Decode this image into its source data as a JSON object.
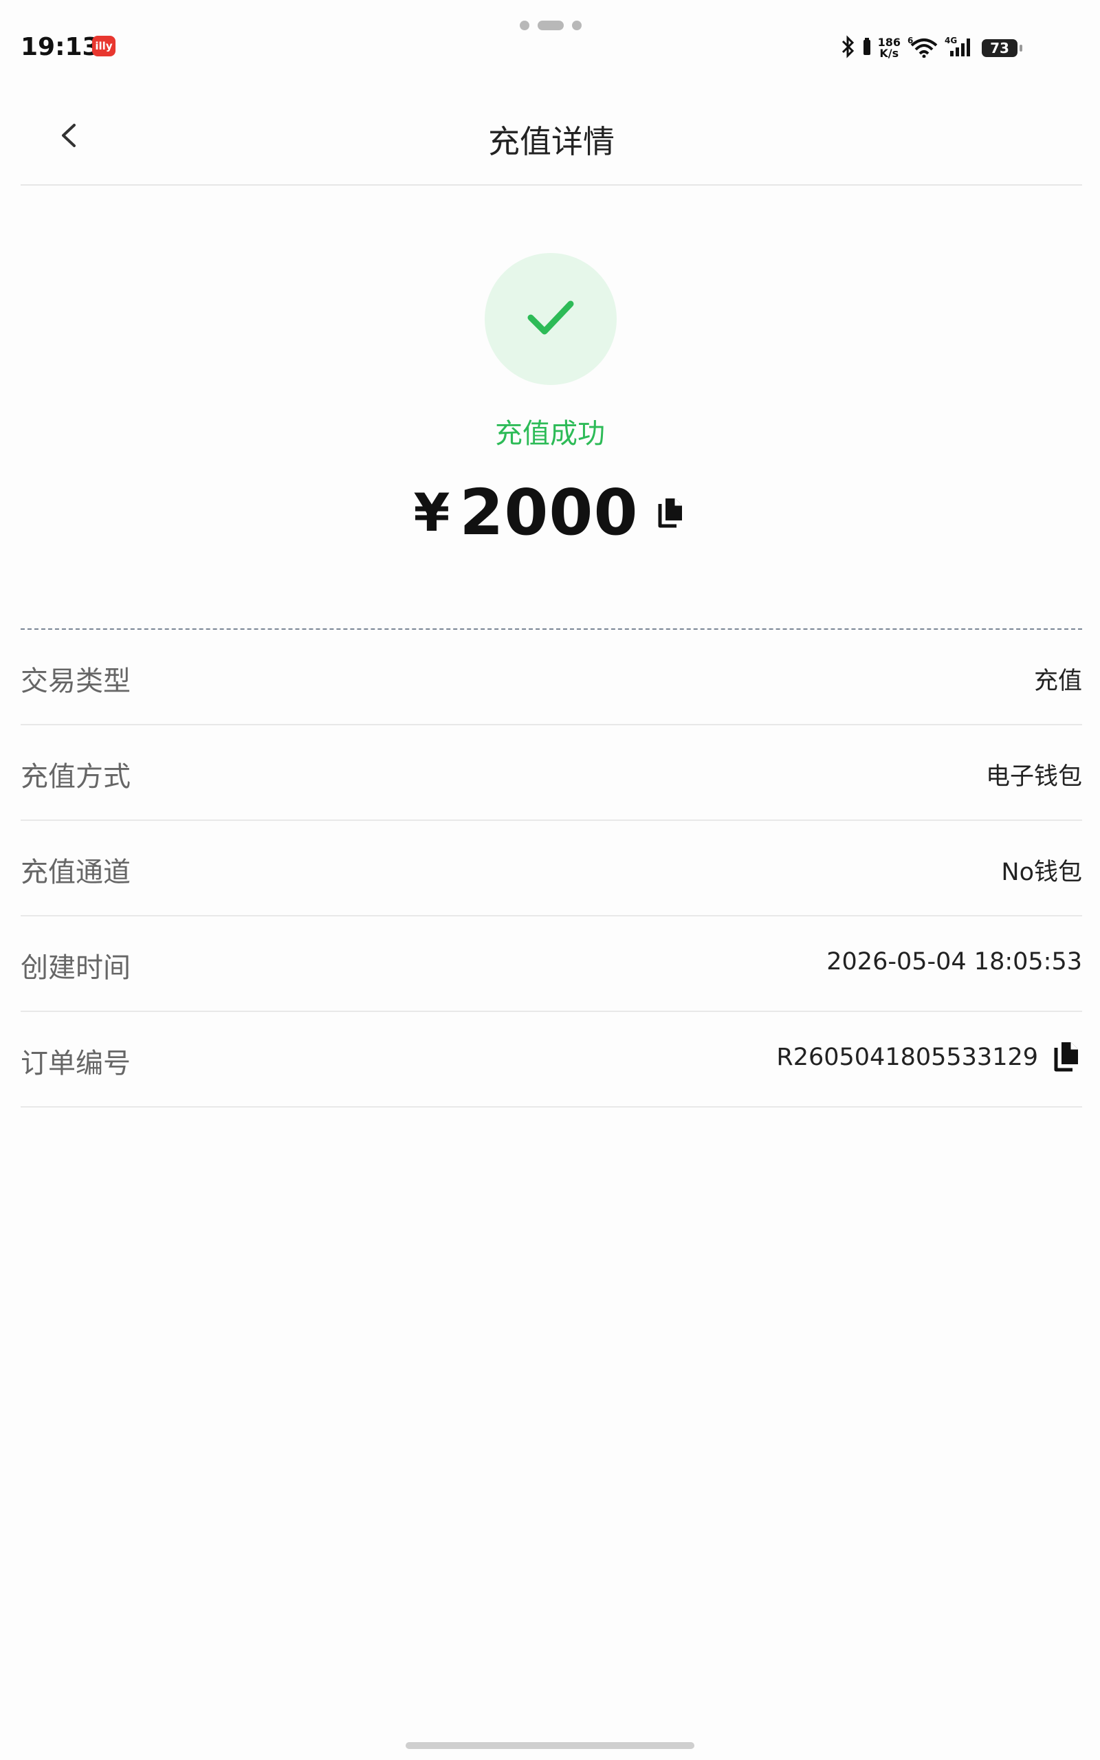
{
  "status_bar": {
    "time": "19:13",
    "app_icon_text": "illy",
    "net_speed_top": "186",
    "net_speed_bottom": "K/s",
    "battery": "73"
  },
  "header": {
    "title": "充值详情"
  },
  "result": {
    "status": "充值成功",
    "currency": "¥",
    "amount": "2000"
  },
  "details": [
    {
      "label": "交易类型",
      "value": "充值"
    },
    {
      "label": "充值方式",
      "value": "电子钱包"
    },
    {
      "label": "充值通道",
      "value": "No钱包"
    },
    {
      "label": "创建时间",
      "value": "2026-05-04 18:05:53"
    },
    {
      "label": "订单编号",
      "value": "R2605041805533129"
    }
  ],
  "colors": {
    "success_green": "#2dbb57",
    "success_bg": "#e6f7ea"
  },
  "icons": {
    "back": "chevron-left-icon",
    "check": "check-icon",
    "copy": "copy-icon"
  }
}
